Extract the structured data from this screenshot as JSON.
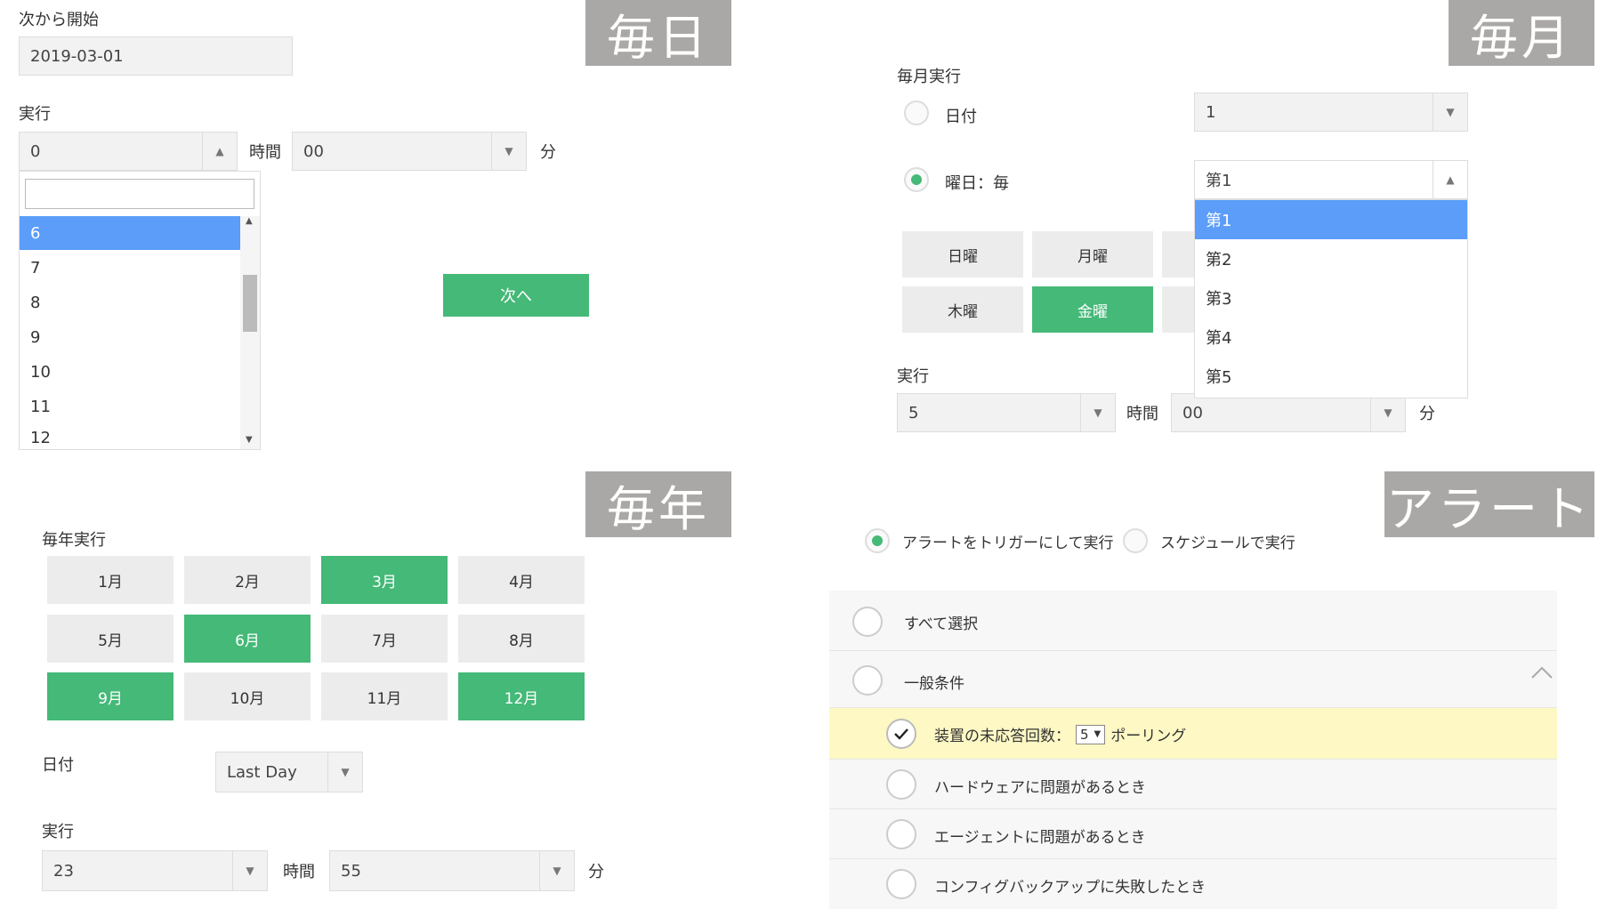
{
  "daily": {
    "tag": "毎日",
    "start_label": "次から開始",
    "start_value": "2019-03-01",
    "run_label": "実行",
    "hour_value": "0",
    "hour_unit": "時間",
    "minute_value": "00",
    "minute_unit": "分",
    "hour_options": [
      "6",
      "7",
      "8",
      "9",
      "10",
      "11",
      "12"
    ],
    "next_button": "次へ"
  },
  "monthly": {
    "tag": "毎月",
    "run_label": "毎月実行",
    "date_option": "日付",
    "date_value": "1",
    "weekday_option": "曜日：毎",
    "week_value": "第1",
    "week_options": [
      "第1",
      "第2",
      "第3",
      "第4",
      "第5"
    ],
    "days": [
      "日曜",
      "月曜",
      "木曜",
      "金曜"
    ],
    "exec_label": "実行",
    "hour_value": "5",
    "hour_unit": "時間",
    "minute_value": "00",
    "minute_unit": "分"
  },
  "yearly": {
    "tag": "毎年",
    "run_label": "毎年実行",
    "months": [
      "1月",
      "2月",
      "3月",
      "4月",
      "5月",
      "6月",
      "7月",
      "8月",
      "9月",
      "10月",
      "11月",
      "12月"
    ],
    "date_label": "日付",
    "date_value": "Last Day",
    "exec_label": "実行",
    "hour_value": "23",
    "hour_unit": "時間",
    "minute_value": "55",
    "minute_unit": "分"
  },
  "alert": {
    "tag": "アラート",
    "trigger_option": "アラートをトリガーにして実行",
    "schedule_option": "スケジュールで実行",
    "select_all": "すべて選択",
    "general": "一般条件",
    "cond1_prefix": "装置の未応答回数：",
    "cond1_value": "5",
    "cond1_suffix": "ポーリング",
    "cond2": "ハードウェアに問題があるとき",
    "cond3": "エージェントに問題があるとき",
    "cond4": "コンフィグバックアップに失敗したとき"
  },
  "colors": {
    "accent": "#45b978",
    "highlight": "#5b9df9",
    "tag_bg": "#aaa8a6",
    "condition_bg": "#fdf8c4"
  }
}
